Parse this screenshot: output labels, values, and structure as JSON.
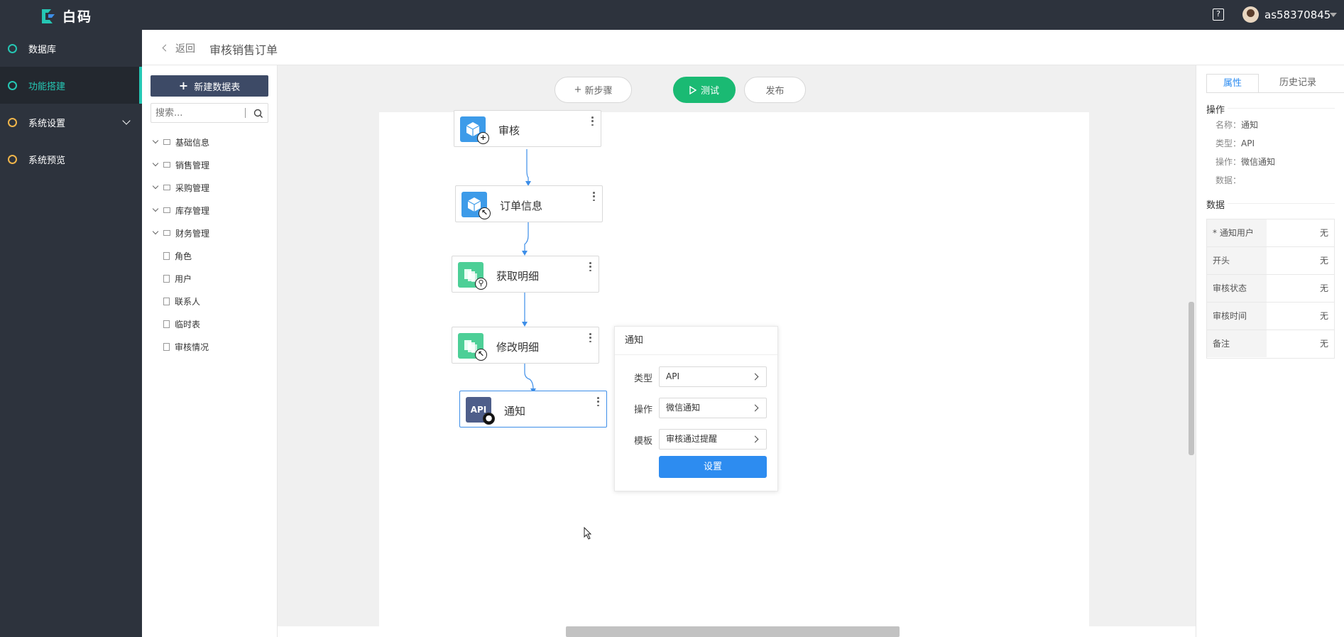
{
  "app": {
    "logo_text": "白码"
  },
  "user": {
    "name": "as58370845"
  },
  "help_icon": "help-icon",
  "nav": {
    "items": [
      {
        "label": "数据库",
        "color": "#25c7b4",
        "active": false
      },
      {
        "label": "功能搭建",
        "color": "#25c7b4",
        "active": true
      },
      {
        "label": "系统设置",
        "color": "#f0b54a",
        "active": false
      },
      {
        "label": "系统预览",
        "color": "#f0b54a",
        "active": false
      }
    ]
  },
  "breadcrumb": {
    "back": "返回",
    "title": "审核销售订单"
  },
  "tablepanel": {
    "new_table": "新建数据表",
    "search_placeholder": "搜索...",
    "folders": [
      "基础信息",
      "销售管理",
      "采购管理",
      "库存管理",
      "财务管理"
    ],
    "tables": [
      "角色",
      "用户",
      "联系人",
      "临时表",
      "审核情况"
    ]
  },
  "toolbar": {
    "new_step": "新步骤",
    "test": "测试",
    "publish": "发布"
  },
  "flow": {
    "nodes": [
      {
        "label": "审核",
        "icon": "cube-icon",
        "badge": "plus-icon"
      },
      {
        "label": "订单信息",
        "icon": "cube-icon",
        "badge": "pointer-icon"
      },
      {
        "label": "获取明细",
        "icon": "stack-icon",
        "badge": "search-icon"
      },
      {
        "label": "修改明细",
        "icon": "stack-icon",
        "badge": "pointer-icon"
      },
      {
        "label": "通知",
        "icon": "api-icon",
        "badge": "wechat-icon",
        "icon_text": "API"
      }
    ]
  },
  "popover": {
    "title": "通知",
    "rows": [
      {
        "label": "类型",
        "value": "API"
      },
      {
        "label": "操作",
        "value": "微信通知"
      },
      {
        "label": "模板",
        "value": "审核通过提醒"
      }
    ],
    "button": "设置"
  },
  "rightpanel": {
    "tabs": [
      "属性",
      "历史记录"
    ],
    "op_section": "操作",
    "props": [
      {
        "key": "名称：",
        "value": "通知"
      },
      {
        "key": "类型：",
        "value": "API"
      },
      {
        "key": "操作：",
        "value": "微信通知"
      },
      {
        "key": "数据：",
        "value": ""
      }
    ],
    "data_section": "数据",
    "data_rows": [
      {
        "key": "* 通知用户",
        "value": "无"
      },
      {
        "key": "开头",
        "value": "无"
      },
      {
        "key": "审核状态",
        "value": "无"
      },
      {
        "key": "审核时间",
        "value": "无"
      },
      {
        "key": "备注",
        "value": "无"
      }
    ]
  }
}
